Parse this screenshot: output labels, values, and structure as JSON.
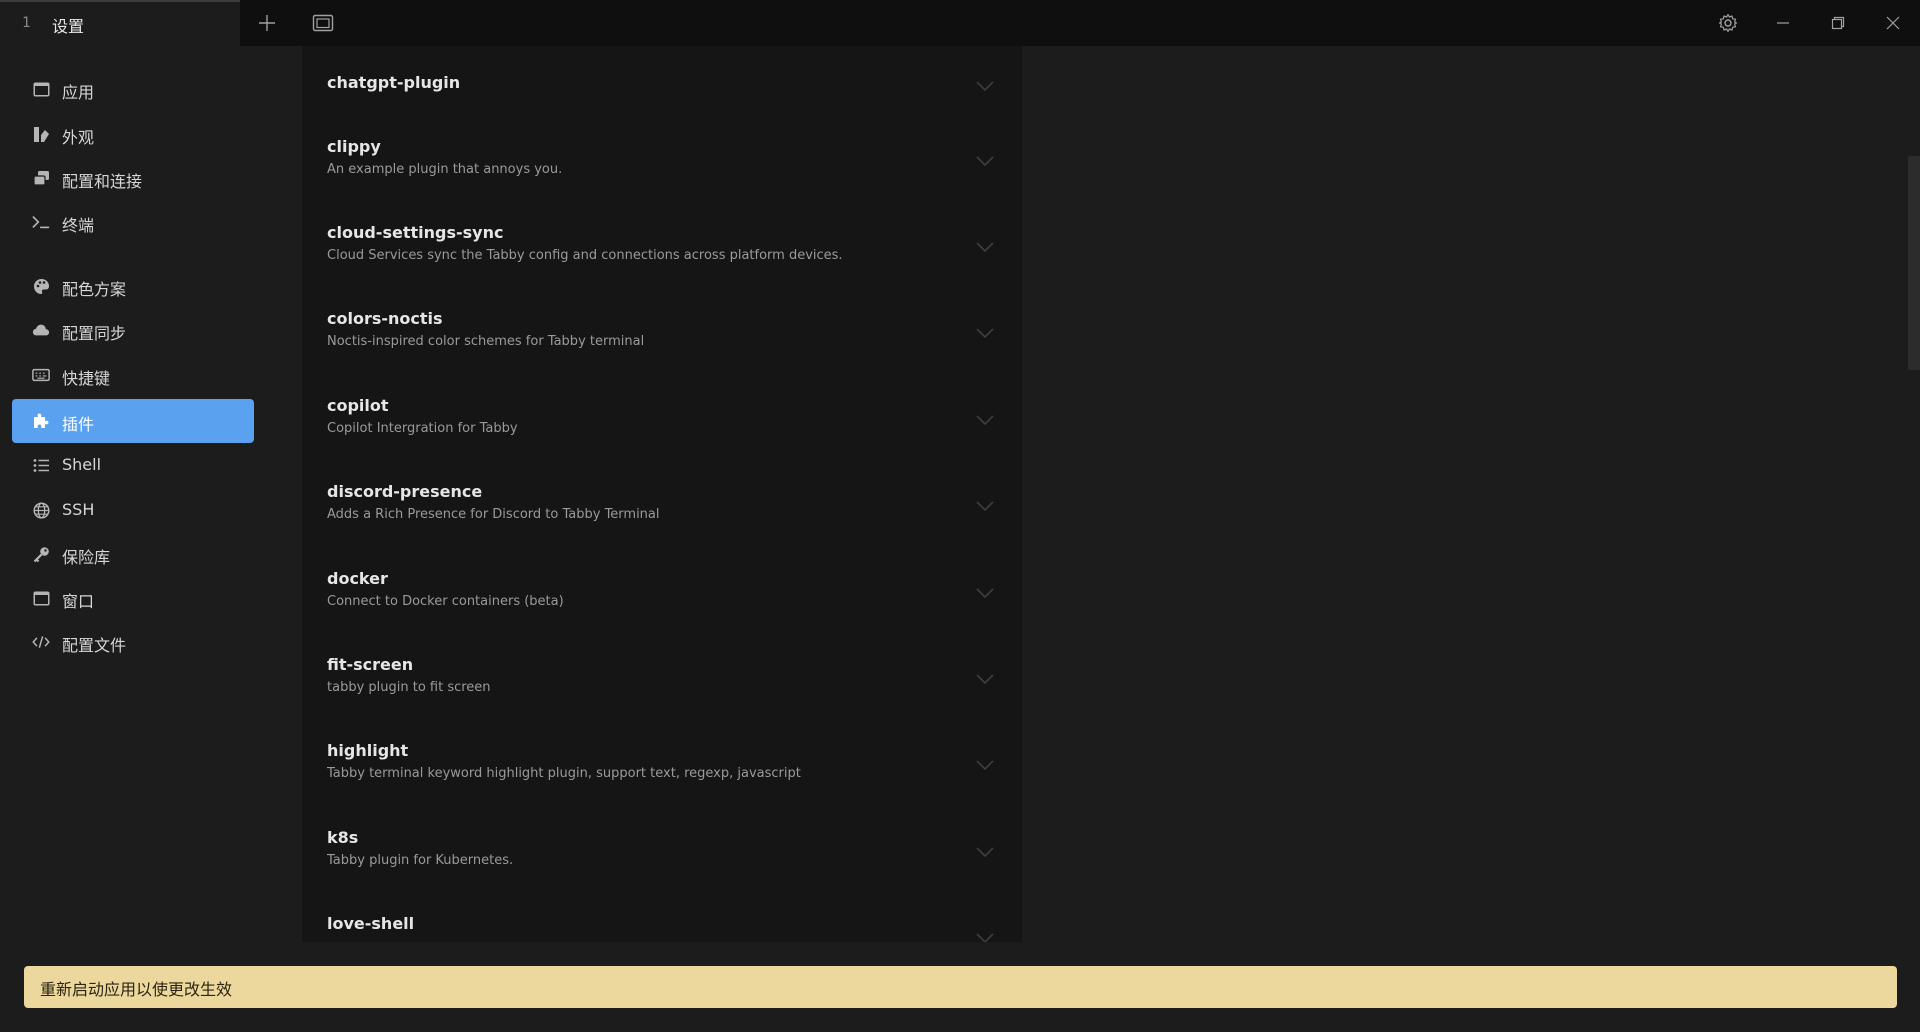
{
  "titlebar": {
    "tab_index": "1",
    "tab_title": "设置",
    "new_tab_icon": "plus-icon",
    "tab_overview_icon": "window-stack-icon",
    "settings_icon": "gear-icon",
    "minimize_icon": "minimize-icon",
    "restore_icon": "restore-icon",
    "close_icon": "close-icon"
  },
  "sidebar": {
    "items": [
      {
        "label": "应用",
        "icon": "app-window-icon"
      },
      {
        "label": "外观",
        "icon": "appearance-icon"
      },
      {
        "label": "配置和连接",
        "icon": "profiles-icon"
      },
      {
        "label": "终端",
        "icon": "terminal-icon"
      },
      {
        "label": "配色方案",
        "icon": "palette-icon"
      },
      {
        "label": "配置同步",
        "icon": "cloud-icon"
      },
      {
        "label": "快捷键",
        "icon": "keyboard-icon"
      },
      {
        "label": "插件",
        "icon": "puzzle-icon",
        "active": true
      },
      {
        "label": "Shell",
        "icon": "list-icon"
      },
      {
        "label": "SSH",
        "icon": "globe-icon"
      },
      {
        "label": "保险库",
        "icon": "key-icon"
      },
      {
        "label": "窗口",
        "icon": "window-icon"
      },
      {
        "label": "配置文件",
        "icon": "code-icon"
      }
    ]
  },
  "plugins": [
    {
      "name": "chatgpt-plugin",
      "description": ""
    },
    {
      "name": "clippy",
      "description": "An example plugin that annoys you."
    },
    {
      "name": "cloud-settings-sync",
      "description": "Cloud Services sync the Tabby config and connections across platform devices."
    },
    {
      "name": "colors-noctis",
      "description": "Noctis-inspired color schemes for Tabby terminal"
    },
    {
      "name": "copilot",
      "description": "Copilot Intergration for Tabby"
    },
    {
      "name": "discord-presence",
      "description": "Adds a Rich Presence for Discord to Tabby Terminal"
    },
    {
      "name": "docker",
      "description": "Connect to Docker containers (beta)"
    },
    {
      "name": "fit-screen",
      "description": "tabby plugin to fit screen"
    },
    {
      "name": "highlight",
      "description": "Tabby terminal keyword highlight plugin, support text, regexp, javascript"
    },
    {
      "name": "k8s",
      "description": "Tabby plugin for Kubernetes."
    },
    {
      "name": "love-shell",
      "description": ""
    }
  ],
  "notice": {
    "text": "重新启动应用以使更改生效"
  },
  "colors": {
    "accent": "#5aa1f0",
    "notice_bg": "#ecd89c",
    "background": "#1c1c1c",
    "panel": "#151515"
  }
}
